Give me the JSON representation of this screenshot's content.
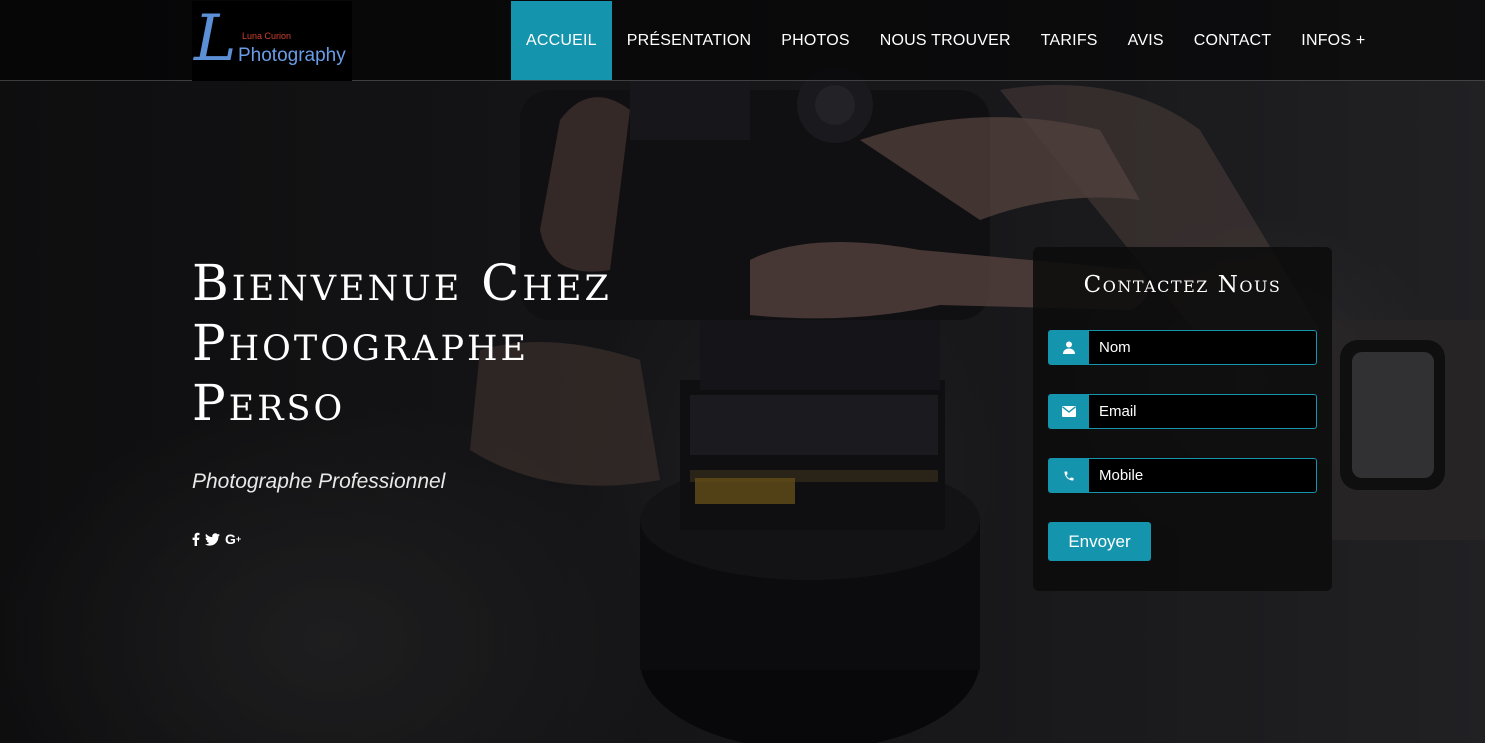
{
  "logo": {
    "mark": "L",
    "small_text": "Luna Curion",
    "big_text": "Photography"
  },
  "nav": {
    "items": [
      {
        "label": "ACCUEIL",
        "active": true
      },
      {
        "label": "PRÉSENTATION",
        "active": false
      },
      {
        "label": "PHOTOS",
        "active": false
      },
      {
        "label": "NOUS TROUVER",
        "active": false
      },
      {
        "label": "TARIFS",
        "active": false
      },
      {
        "label": "AVIS",
        "active": false
      },
      {
        "label": "CONTACT",
        "active": false
      },
      {
        "label": "INFOS +",
        "active": false
      }
    ]
  },
  "hero": {
    "headline_line1": "Bienvenue Chez",
    "headline_line2": "Photographe",
    "headline_line3": "Perso",
    "subtitle": "Photographe Professionnel",
    "social": [
      {
        "icon": "facebook-icon",
        "glyph": "f"
      },
      {
        "icon": "twitter-icon",
        "glyph": "t"
      },
      {
        "icon": "google-plus-icon",
        "glyph": "G+"
      }
    ]
  },
  "contact": {
    "title": "Contactez Nous",
    "fields": {
      "name": {
        "placeholder": "Nom",
        "icon": "user-icon"
      },
      "email": {
        "placeholder": "Email",
        "icon": "envelope-icon"
      },
      "mobile": {
        "placeholder": "Mobile",
        "icon": "phone-icon"
      }
    },
    "submit_label": "Envoyer"
  },
  "colors": {
    "accent": "#1595ad",
    "nav_text": "#ffffff",
    "logo_blue": "#6a9de6",
    "logo_red": "#d04030"
  }
}
